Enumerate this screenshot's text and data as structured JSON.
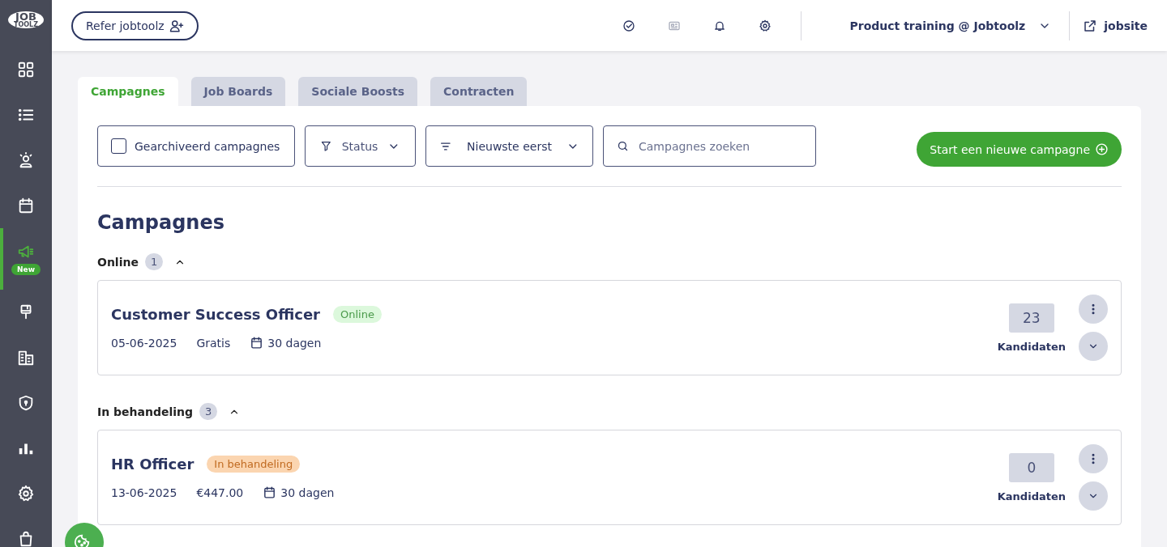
{
  "logo": {
    "line1": "JOB",
    "line2": "TOOLZ"
  },
  "sidebar": {
    "items": [
      {
        "selected": false
      },
      {
        "selected": false
      },
      {
        "selected": false
      },
      {
        "selected": false
      },
      {
        "selected": true,
        "badge": "New"
      },
      {
        "selected": false
      },
      {
        "selected": false
      },
      {
        "selected": false
      },
      {
        "selected": false
      },
      {
        "selected": false
      },
      {
        "selected": false
      }
    ]
  },
  "topbar": {
    "refer_button": "Refer jobtoolz",
    "toolbar_icons": [
      {
        "disabled": false
      },
      {
        "disabled": true
      },
      {
        "disabled": false
      },
      {
        "disabled": false
      }
    ],
    "account": "Product training @ Jobtoolz",
    "site_link": "jobsite"
  },
  "tabs": [
    {
      "label": "Campagnes",
      "selected": true
    },
    {
      "label": "Job Boards",
      "selected": false
    },
    {
      "label": "Sociale Boosts",
      "selected": false
    },
    {
      "label": "Contracten",
      "selected": false
    }
  ],
  "filters": {
    "archived": {
      "label": "Gearchiveerd campagnes",
      "checked": false
    },
    "status": "Status",
    "sort": "Nieuwste eerst",
    "search": {
      "placeholder": "Campagnes zoeken"
    },
    "new_button": "Start een nieuwe campagne"
  },
  "heading": "Campagnes",
  "groups": [
    {
      "label": "Online",
      "count": "1",
      "expanded": true,
      "campaigns": [
        {
          "kind": "full",
          "title": "Customer Success Officer",
          "status": {
            "label": "Online",
            "kind": "online"
          },
          "date": "05-06-2025",
          "price": "Gratis",
          "duration": "30 dagen",
          "candidates": "23",
          "candidates_label": "Kandidaten"
        }
      ]
    },
    {
      "label": "In behandeling",
      "count": "3",
      "expanded": true,
      "campaigns": [
        {
          "kind": "full",
          "title": "HR Officer",
          "status": {
            "label": "In behandeling",
            "kind": "pending"
          },
          "date": "13-06-2025",
          "price": "€447.00",
          "duration": "30 dagen",
          "candidates": "0",
          "candidates_label": "Kandidaten"
        },
        {
          "kind": "partial"
        }
      ]
    }
  ]
}
